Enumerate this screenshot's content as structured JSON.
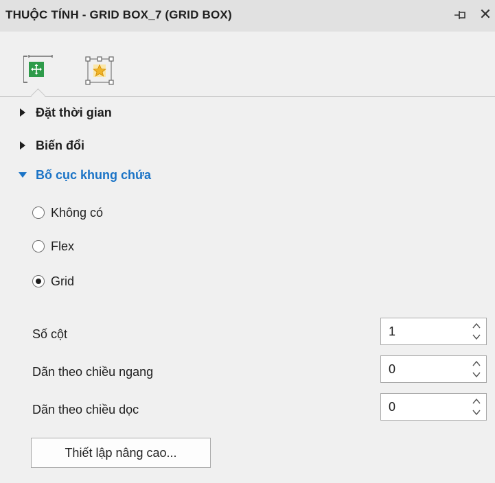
{
  "window": {
    "title": "THUỘC TÍNH - GRID BOX_7 (GRID BOX)",
    "pin_icon": "pin-icon",
    "close_glyph": "✕"
  },
  "tabs": [
    {
      "icon": "layout-move-icon",
      "selected": true
    },
    {
      "icon": "effects-star-icon",
      "selected": false
    }
  ],
  "sections": {
    "timing": {
      "label": "Đặt thời gian",
      "expanded": false
    },
    "transform": {
      "label": "Biến đổi",
      "expanded": false
    },
    "container_layout": {
      "label": "Bố cục khung chứa",
      "expanded": true
    }
  },
  "layout_options": {
    "none": "Không có",
    "flex": "Flex",
    "grid": "Grid",
    "selected": "Grid"
  },
  "fields": {
    "columns": {
      "label": "Số cột",
      "value": "1"
    },
    "horizontal_gap": {
      "label": "Dãn theo chiều ngang",
      "value": "0"
    },
    "vertical_gap": {
      "label": "Dãn theo chiều dọc",
      "value": "0"
    }
  },
  "advanced_button": "Thiết lập nâng cao...",
  "colors": {
    "accent": "#1a73c6",
    "panel_bg": "#f0f0f0",
    "titlebar_bg": "#e1e1e1",
    "layout_icon_green": "#2e9b4a",
    "effects_icon_gold": "#f0b429"
  }
}
